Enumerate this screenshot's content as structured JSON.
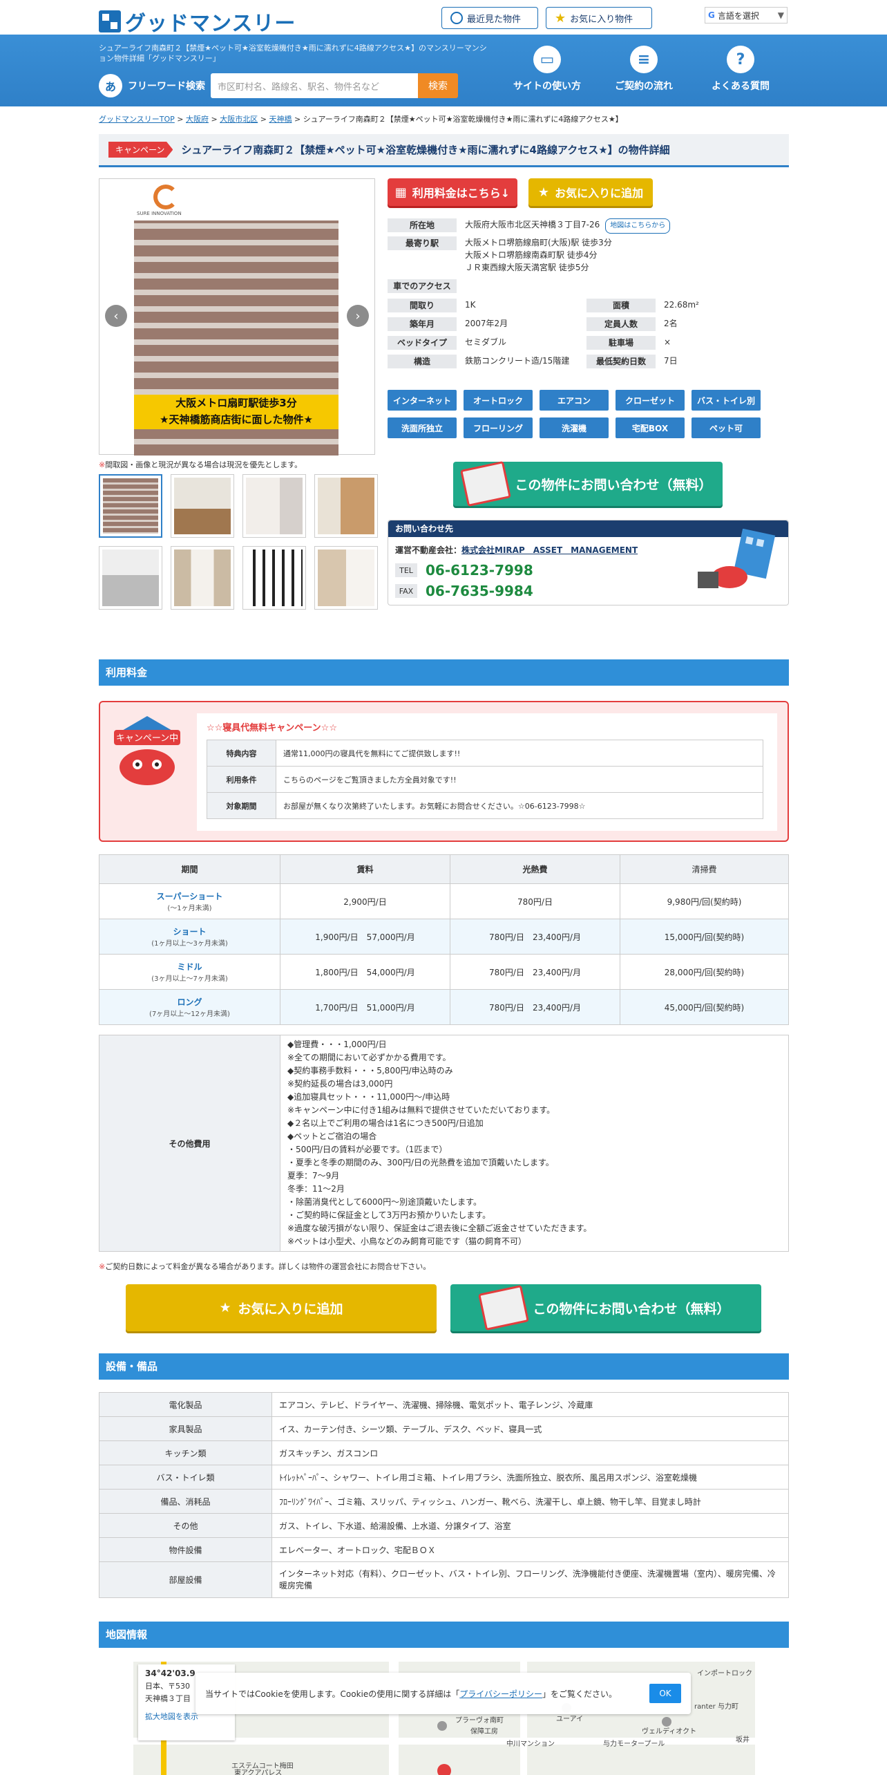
{
  "header": {
    "logo_text": "グッドマンスリー",
    "recent_label": "最近見た物件",
    "favorites_label": "お気に入り物件",
    "lang_label": "言語を選択",
    "description": "シュアーライフ南森町２【禁煙★ペット可★浴室乾燥機付き★雨に濡れずに4路線アクセス★】のマンスリーマンション物件詳細「グッドマンスリー」",
    "freeword_icon": "あ",
    "freeword_label": "フリーワード検索",
    "search_placeholder": "市区町村名、路線名、駅名、物件名など",
    "search_button": "検索",
    "nav": [
      "サイトの使い方",
      "ご契約の流れ",
      "よくある質問"
    ]
  },
  "breadcrumb": {
    "top": "グッドマンスリーTOP",
    "pref": "大阪府",
    "city": "大阪市北区",
    "area": "天神橋",
    "current": "シュアーライフ南森町２【禁煙★ペット可★浴室乾燥機付き★雨に濡れずに4路線アクセス★】",
    "sep": ">"
  },
  "property": {
    "campaign_tag": "キャンペーン",
    "title": "シュアーライフ南森町２【禁煙★ペット可★浴室乾燥機付き★雨に濡れずに4路線アクセス★】の物件詳細",
    "photo_caption": "大阪メトロ扇町駅徒歩3分\n★天神橋筋商店街に面した物件★",
    "photo_logo_text": "SURE INNOVATION",
    "photo_note_mark": "※",
    "photo_note": "間取図・画像と現況が異なる場合は現況を優先とします。",
    "price_button": "利用料金はこちら↓",
    "fav_button": "お気に入りに追加",
    "specs": {
      "address_label": "所在地",
      "address": "大阪府大阪市北区天神橋３丁目7-26",
      "map_button": "地図はこちらから",
      "station_label": "最寄り駅",
      "stations": [
        "大阪メトロ堺筋線扇町(大阪)駅 徒歩3分",
        "大阪メトロ堺筋線南森町駅 徒歩4分",
        "ＪＲ東西線大阪天満宮駅 徒歩5分"
      ],
      "car_label": "車でのアクセス",
      "layout_label": "間取り",
      "layout": "1K",
      "area_label": "面積",
      "area": "22.68m²",
      "built_label": "築年月",
      "built": "2007年2月",
      "capacity_label": "定員人数",
      "capacity": "2名",
      "bed_label": "ベッドタイプ",
      "bed": "セミダブル",
      "parking_label": "駐車場",
      "parking": "×",
      "structure_label": "構造",
      "structure": "鉄筋コンクリート造/15階建",
      "min_days_label": "最低契約日数",
      "min_days": "7日"
    },
    "tags": [
      "インターネット",
      "オートロック",
      "エアコン",
      "クローゼット",
      "バス・トイレ別",
      "洗面所独立",
      "フローリング",
      "洗濯機",
      "宅配BOX",
      "ペット可"
    ],
    "inquiry_button": "この物件にお問い合わせ（無料）",
    "contact": {
      "header": "お問い合わせ先",
      "company_label": "運営不動産会社：",
      "company": "株式会社MIRAP　ASSET　MANAGEMENT",
      "tel_label": "TEL",
      "tel": "06-6123-7998",
      "fax_label": "FAX",
      "fax": "06-7635-9984"
    }
  },
  "pricing": {
    "section_title": "利用料金",
    "campaign_badge": "キャンペーン中",
    "campaign_title": "☆☆寝具代無料キャンペーン☆☆",
    "campaign_rows": [
      {
        "k": "特典内容",
        "v": "通常11,000円の寝具代を無料にてご提供致します!!"
      },
      {
        "k": "利用条件",
        "v": "こちらのページをご覧頂きました方全員対象です!!"
      },
      {
        "k": "対象期間",
        "v": "お部屋が無くなり次第終了いたします。お気軽にお問合せください。☆06-6123-7998☆"
      }
    ],
    "headers": [
      "期間",
      "賃料",
      "光熱費",
      "清掃費"
    ],
    "rows": [
      {
        "plan": "スーパーショート",
        "range": "(～1ヶ月未満)",
        "rent": "2,900円/日",
        "util": "780円/日",
        "clean": "9,980円/回(契約時)"
      },
      {
        "plan": "ショート",
        "range": "(1ヶ月以上～3ヶ月未満)",
        "rent": "1,900円/日　57,000円/月",
        "util": "780円/日　23,400円/月",
        "clean": "15,000円/回(契約時)"
      },
      {
        "plan": "ミドル",
        "range": "(3ヶ月以上～7ヶ月未満)",
        "rent": "1,800円/日　54,000円/月",
        "util": "780円/日　23,400円/月",
        "clean": "28,000円/回(契約時)"
      },
      {
        "plan": "ロング",
        "range": "(7ヶ月以上～12ヶ月未満)",
        "rent": "1,700円/日　51,000円/月",
        "util": "780円/日　23,400円/月",
        "clean": "45,000円/回(契約時)"
      }
    ],
    "other_label": "その他費用",
    "other_lines": [
      "◆管理費・・・1,000円/日",
      "※全ての期間において必ずかかる費用です。",
      "◆契約事務手数料・・・5,800円/申込時のみ",
      "※契約延長の場合は3,000円",
      "◆追加寝具セット・・・11,000円～/申込時",
      "※キャンペーン中に付き1組みは無料で提供させていただいております。",
      "◆２名以上でご利用の場合は1名につき500円/日追加",
      "◆ペットとご宿泊の場合",
      "・500円/日の賃料が必要です。（1匹まで）",
      "・夏季と冬季の期間のみ、300円/日の光熱費を追加で頂戴いたします。",
      "夏季：7～9月",
      "冬季：11～2月",
      "・除菌消臭代として6000円〜別途頂戴いたします。",
      "・ご契約時に保証金として3万円お預かりいたします。",
      "※過度な破汚損がない限り、保証金はご退去後に全額ご返金させていただきます。",
      "※ペットは小型犬、小鳥などのみ飼育可能です（猫の飼育不可）"
    ],
    "note_mark": "※",
    "note": "ご契約日数によって料金が異なる場合があります。詳しくは物件の運営会社にお問合せ下さい。",
    "fav_button": "お気に入りに追加",
    "inquiry_button": "この物件にお問い合わせ（無料）"
  },
  "facilities": {
    "section_title": "設備・備品",
    "rows": [
      {
        "k": "電化製品",
        "v": "エアコン、テレビ、ドライヤー、洗濯機、掃除機、電気ポット、電子レンジ、冷蔵庫"
      },
      {
        "k": "家具製品",
        "v": "イス、カーテン付き、シーツ類、テーブル、デスク、ベッド、寝具一式"
      },
      {
        "k": "キッチン類",
        "v": "ガスキッチン、ガスコンロ"
      },
      {
        "k": "バス・トイレ類",
        "v": "ﾄｲﾚｯﾄﾍﾟｰﾊﾟｰ、シャワー、トイレ用ゴミ箱、トイレ用ブラシ、洗面所独立、脱衣所、風呂用スポンジ、浴室乾燥機"
      },
      {
        "k": "備品、消耗品",
        "v": "ﾌﾛｰﾘﾝｸﾞﾜｲﾊﾟｰ、ゴミ箱、スリッパ、ティッシュ、ハンガー、靴べら、洗濯干し、卓上鏡、物干し竿、目覚まし時計"
      },
      {
        "k": "その他",
        "v": "ガス、トイレ、下水道、給湯設備、上水道、分譲タイプ、浴室"
      },
      {
        "k": "物件設備",
        "v": "エレベーター、オートロック、宅配ＢＯＸ"
      },
      {
        "k": "部屋設備",
        "v": "インターネット対応（有料）、クローゼット、バス・トイレ別、フローリング、洗浄機能付き便座、洗濯機置場（室内）、暖房完備、冷暖房完備"
      }
    ]
  },
  "map": {
    "section_title": "地図情報",
    "coord": "34°42'03.9",
    "addr1": "日本、〒530",
    "addr2": "天神橋３丁目",
    "expand": "拡大地図を表示",
    "labels": [
      "インポートロック",
      "ranter 与力町",
      "与力モータープール",
      "ヴェルディオクト",
      "中川マンション",
      "保障工房",
      "ユーアイ",
      "プラーヴォ南町",
      "エステムコート梅田",
      "東アクアパレス",
      "坂井"
    ],
    "cookie_text_a": "当サイトではCookieを使用します。Cookieの使用に関する詳細は「",
    "cookie_link": "プライバシーポリシー",
    "cookie_text_b": "」をご覧ください。",
    "cookie_ok": "OK"
  },
  "colors": {
    "primary": "#2f80c8",
    "accent_red": "#e33d3d",
    "accent_yellow": "#e5b700",
    "accent_green": "#1faa8a",
    "search_orange": "#f08a24"
  }
}
